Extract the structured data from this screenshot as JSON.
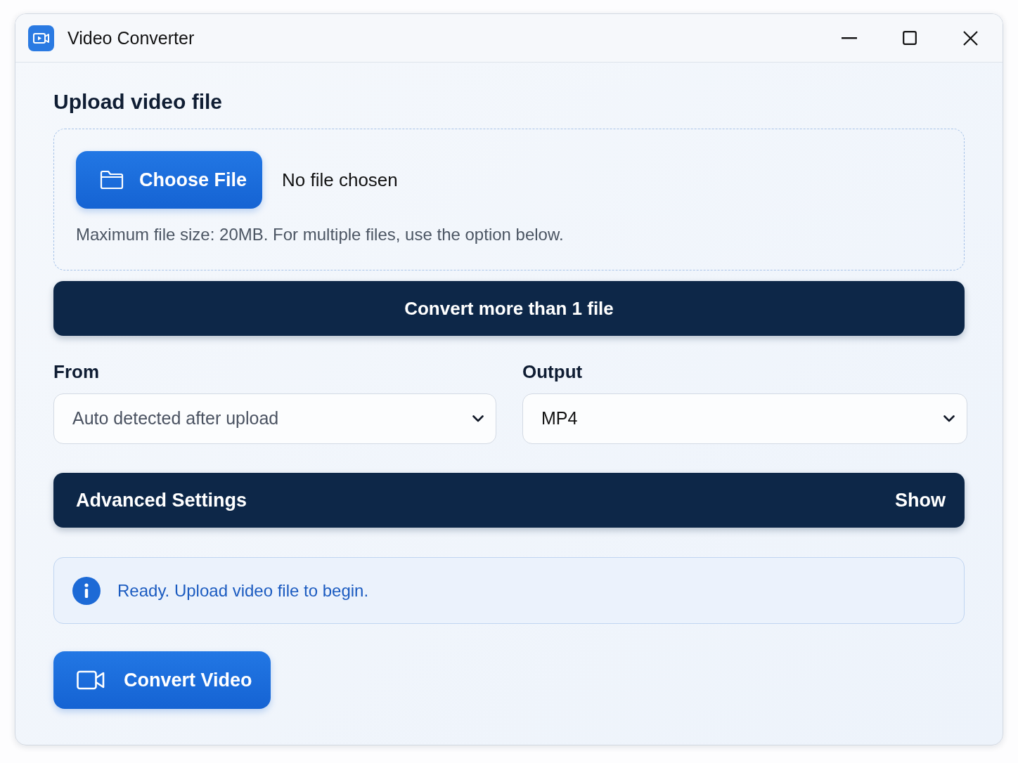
{
  "window": {
    "title": "Video Converter"
  },
  "upload": {
    "heading": "Upload video file",
    "choose_button": "Choose File",
    "file_status": "No file chosen",
    "hint": "Maximum file size: 20MB. For multiple files, use the option below."
  },
  "batch_button": "Convert more than 1 file",
  "fields": [
    {
      "label": "From",
      "placeholder": "Auto detected after upload"
    },
    {
      "label": "Output",
      "value": "MP4"
    }
  ],
  "advanced": {
    "title": "Advanced Settings",
    "toggle": "Show"
  },
  "status": {
    "message": "Ready. Upload video file to begin."
  },
  "convert_button": "Convert Video"
}
